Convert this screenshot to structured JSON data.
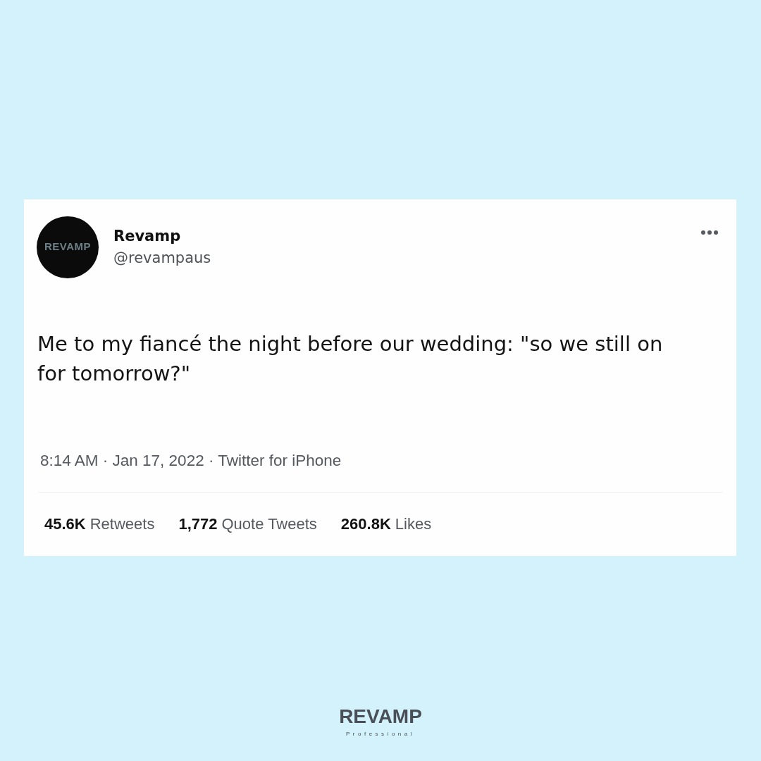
{
  "tweet": {
    "avatar": {
      "logo_text": "REVAMP"
    },
    "name": "Revamp",
    "handle": "@revampaus",
    "text": "Me to my fiancé the night before our wedding: \"so we still on for tomorrow?\"",
    "meta": "8:14 AM · Jan 17, 2022 · Twitter for iPhone",
    "stats": [
      {
        "count": "45.6K",
        "label": "Retweets"
      },
      {
        "count": "1,772",
        "label": "Quote Tweets"
      },
      {
        "count": "260.8K",
        "label": "Likes"
      }
    ]
  },
  "brand": {
    "name": "REVAMP",
    "tagline": "Professional"
  }
}
